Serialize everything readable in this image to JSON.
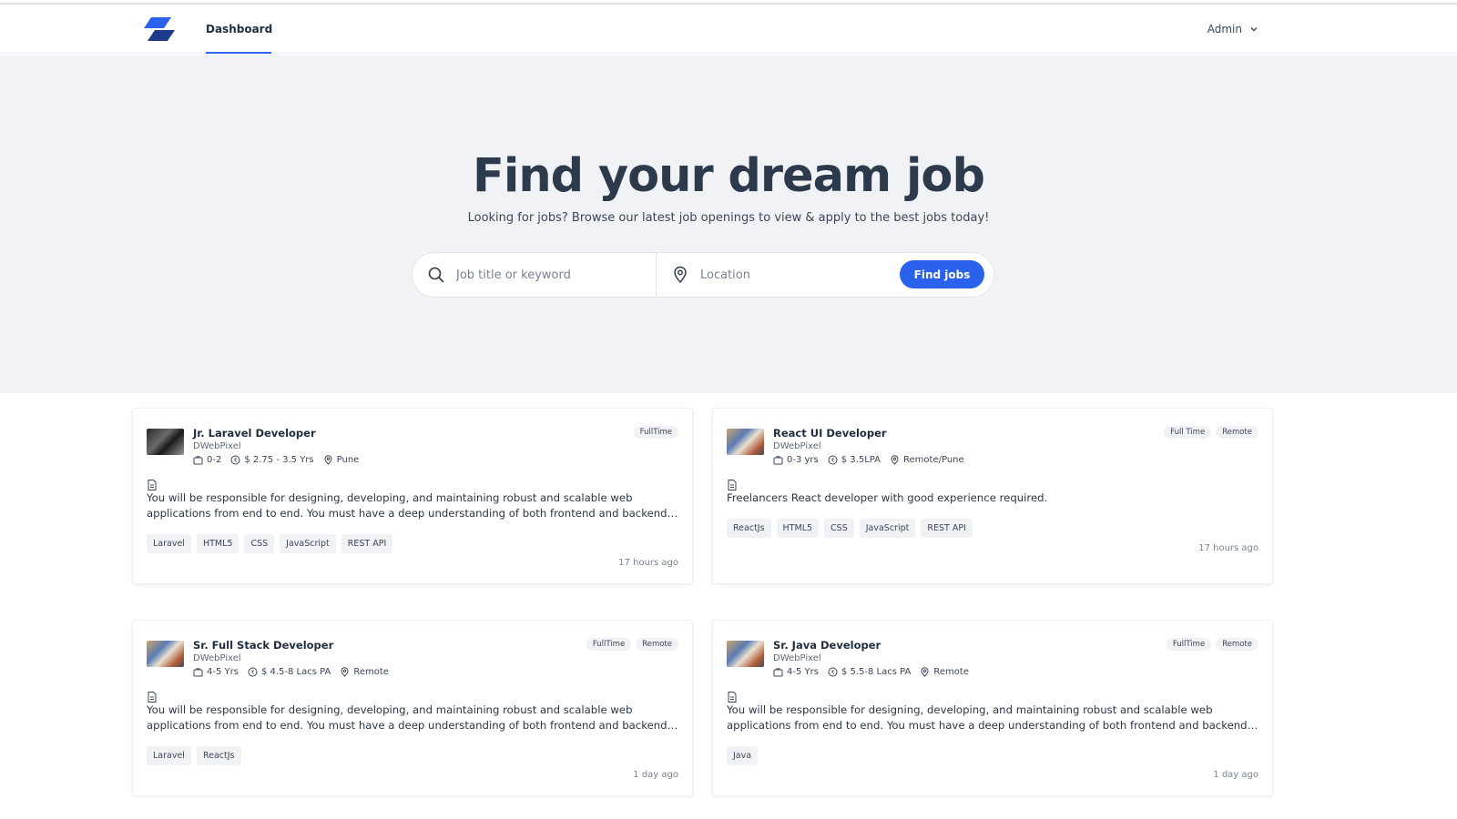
{
  "nav": {
    "links": [
      "Dashboard"
    ],
    "user_label": "Admin"
  },
  "hero": {
    "title": "Find your dream job",
    "subtitle": "Looking for jobs? Browse our latest job openings to view & apply to the best jobs today!",
    "keyword_placeholder": "Job title or keyword",
    "location_placeholder": "Location",
    "button_label": "Find jobs"
  },
  "jobs": [
    {
      "title": "Jr. Laravel Developer",
      "company": "DWebPixel",
      "experience": "0-2",
      "salary": "$ 2.75 - 3.5 Yrs",
      "location": "Pune",
      "badges": [
        "FullTime"
      ],
      "description": "You will be responsible for designing, developing, and maintaining robust and scalable web applications from end to end. You must have a deep understanding of both frontend and backend technologies.",
      "tags": [
        "Laravel",
        "HTML5",
        "CSS",
        "JavaScript",
        "REST API"
      ],
      "posted": "17 hours ago"
    },
    {
      "title": "React UI Developer",
      "company": "DWebPixel",
      "experience": "0-3 yrs",
      "salary": "$ 3.5LPA",
      "location": "Remote/Pune",
      "badges": [
        "Full Time",
        "Remote"
      ],
      "description": "Freelancers React developer with good experience required.",
      "tags": [
        "ReactJs",
        "HTML5",
        "CSS",
        "JavaScript",
        "REST API"
      ],
      "posted": "17 hours ago"
    },
    {
      "title": "Sr. Full Stack Developer",
      "company": "DWebPixel",
      "experience": "4-5 Yrs",
      "salary": "$ 4.5-8 Lacs PA",
      "location": "Remote",
      "badges": [
        "FullTime",
        "Remote"
      ],
      "description": "You will be responsible for designing, developing, and maintaining robust and scalable web applications from end to end. You must have a deep understanding of both frontend and backend technologies.",
      "tags": [
        "Laravel",
        "ReactJs"
      ],
      "posted": "1 day ago"
    },
    {
      "title": "Sr. Java Developer",
      "company": "DWebPixel",
      "experience": "4-5 Yrs",
      "salary": "$ 5.5-8 Lacs PA",
      "location": "Remote",
      "badges": [
        "FullTime",
        "Remote"
      ],
      "description": "You will be responsible for designing, developing, and maintaining robust and scalable web applications from end to end. You must have a deep understanding of both frontend and backend technologies.",
      "tags": [
        "Java"
      ],
      "posted": "1 day ago"
    }
  ],
  "colors": {
    "accent": "#2a62ee",
    "hero_bg": "#f1f2f5",
    "heading": "#2d3a4b"
  },
  "icons": [
    "logo",
    "chevron-down-icon",
    "search-icon",
    "location-pin-icon",
    "briefcase-icon",
    "currency-icon",
    "document-icon"
  ]
}
